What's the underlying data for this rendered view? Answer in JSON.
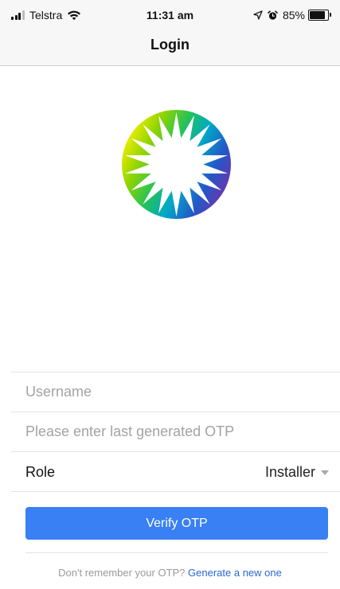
{
  "status_bar": {
    "carrier": "Telstra",
    "time": "11:31 am",
    "battery_percent": "85%",
    "battery_level": 0.85,
    "icons": [
      "signal-icon",
      "wifi-icon",
      "location-arrow-icon",
      "alarm-icon",
      "battery-icon"
    ]
  },
  "nav": {
    "title": "Login"
  },
  "logo": {
    "icon": "sunburst-logo"
  },
  "form": {
    "username": {
      "value": "",
      "placeholder": "Username"
    },
    "otp": {
      "value": "",
      "placeholder": "Please enter last generated OTP"
    },
    "role": {
      "label": "Role",
      "selected": "Installer"
    },
    "verify_label": "Verify OTP"
  },
  "footer": {
    "question": "Don't remember your OTP? ",
    "link": "Generate a new one"
  },
  "colors": {
    "accent": "#3880f4",
    "link": "#2a67d8",
    "placeholder": "#a3a3a3"
  }
}
